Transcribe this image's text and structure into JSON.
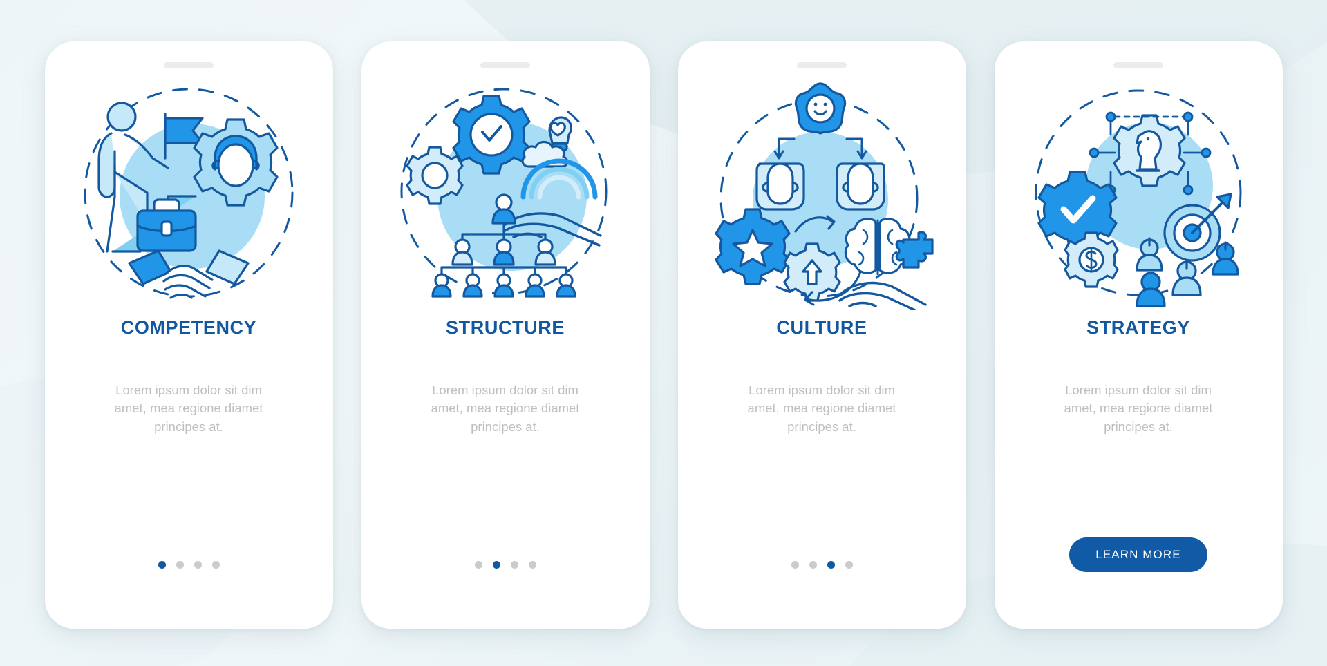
{
  "theme": {
    "title_color": "#1258a0",
    "body_color": "#bdbfc3",
    "accent_dark": "#115aa6",
    "accent_mid": "#2196e8",
    "accent_light": "#a9ddf5",
    "accent_pale": "#d3ecfa",
    "stroke": "#1459a0",
    "dot_inactive": "#c9cbce",
    "background": "#eef5f7"
  },
  "cards": [
    {
      "illustration_name": "competency-illustration",
      "illustration_elements": [
        "person-climbing-stairs",
        "flag-icon",
        "gear-with-person-icon",
        "briefcase-icon",
        "handshake-icon",
        "dashed-circle"
      ],
      "title": "COMPETENCY",
      "body": "Lorem ipsum dolor sit dim amet, mea regione diamet principes at.",
      "footer_type": "dots",
      "dots": {
        "count": 4,
        "active_index": 0
      }
    },
    {
      "illustration_name": "structure-illustration",
      "illustration_elements": [
        "gear-with-checkmark-icon",
        "small-gear-icon",
        "lightbulb-heart-icon",
        "hand-icon",
        "org-chart-icon",
        "dashed-circle"
      ],
      "title": "STRUCTURE",
      "body": "Lorem ipsum dolor sit dim amet, mea regione diamet principes at.",
      "footer_type": "dots",
      "dots": {
        "count": 4,
        "active_index": 1
      }
    },
    {
      "illustration_name": "culture-illustration",
      "illustration_elements": [
        "smiley-star-icon",
        "two-people-icon",
        "star-gear-icon",
        "brain-puzzle-icon",
        "arrow-gear-icon",
        "hand-icon",
        "dashed-circle"
      ],
      "title": "CULTURE",
      "body": "Lorem ipsum dolor sit dim amet, mea regione diamet principes at.",
      "footer_type": "dots",
      "dots": {
        "count": 4,
        "active_index": 2
      }
    },
    {
      "illustration_name": "strategy-illustration",
      "illustration_elements": [
        "chess-knight-gear-icon",
        "network-nodes-icon",
        "checkmark-gear-icon",
        "dollar-gear-icon",
        "target-arrow-icon",
        "team-people-icon",
        "dashed-circle"
      ],
      "title": "STRATEGY",
      "body": "Lorem ipsum dolor sit dim amet, mea regione diamet principes at.",
      "footer_type": "button",
      "cta_label": "LEARN MORE"
    }
  ]
}
